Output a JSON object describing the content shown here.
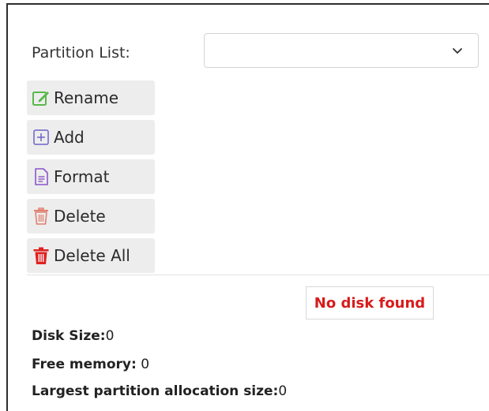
{
  "partition": {
    "label": "Partition List:",
    "selected": ""
  },
  "actions": [
    {
      "label": "Rename",
      "icon": "rename-icon"
    },
    {
      "label": "Add",
      "icon": "add-icon"
    },
    {
      "label": "Format",
      "icon": "format-icon"
    },
    {
      "label": "Delete",
      "icon": "delete-icon"
    },
    {
      "label": "Delete All",
      "icon": "delete-all-icon"
    }
  ],
  "status": {
    "no_disk": "No disk found"
  },
  "info": {
    "disk_size_label": "Disk Size:",
    "disk_size_value": "0",
    "free_memory_label": "Free memory:",
    "free_memory_value": " 0",
    "largest_label": "Largest partition allocation size:",
    "largest_value": "0"
  },
  "colors": {
    "rename": "#58b84a",
    "add": "#6b63c9",
    "format": "#8a55c9",
    "delete": "#e08070",
    "delete_all": "#e02020",
    "error_text": "#d81b1b"
  }
}
